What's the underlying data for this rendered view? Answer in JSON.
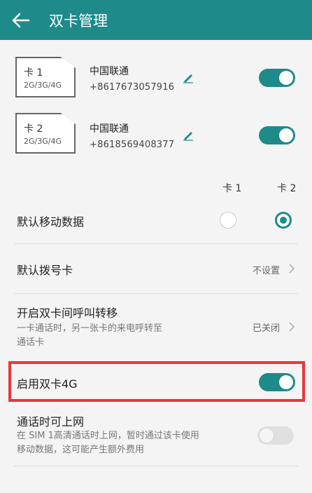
{
  "header": {
    "title": "双卡管理"
  },
  "sims": [
    {
      "card": "卡 1",
      "bands": "2G/3G/4G",
      "carrier": "中国联通",
      "phone": "+8617673057916",
      "enabled": true
    },
    {
      "card": "卡 2",
      "bands": "2G/3G/4G",
      "carrier": "中国联通",
      "phone": "+8618569408377",
      "enabled": true
    }
  ],
  "columns": {
    "card1": "卡 1",
    "card2": "卡 2"
  },
  "settings": {
    "default_data": {
      "label": "默认移动数据",
      "selected": "卡 2"
    },
    "default_dial": {
      "label": "默认拨号卡",
      "value": "不设置"
    },
    "call_forward": {
      "label": "开启双卡间呼叫转移",
      "sub_line1": "一卡通话时，另一张卡的来电呼转至",
      "sub_line2": "通话卡",
      "value": "已关闭"
    },
    "dual_4g": {
      "label": "启用双卡4G",
      "enabled": true
    },
    "data_during_call": {
      "label": "通话时可上网",
      "sub_line1": "在 SIM 1高清通话时上网，暂时通过该卡使用",
      "sub_line2": "移动数据，这可能产生额外费用",
      "enabled": false
    }
  },
  "colors": {
    "accent": "#1f8a8a",
    "highlight": "#e8383a"
  }
}
